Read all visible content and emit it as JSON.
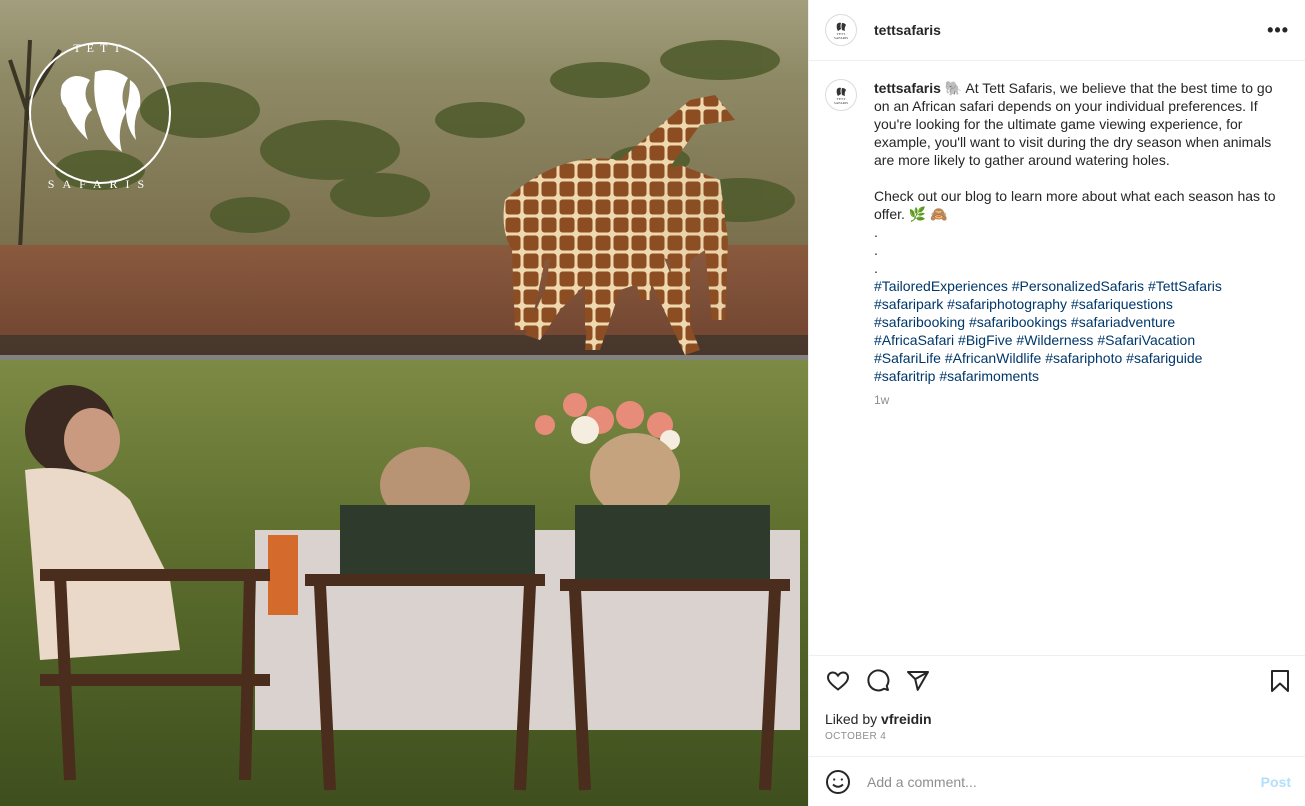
{
  "post": {
    "brand_logo_text": "TETT SAFARIS",
    "username": "tettsafaris",
    "caption": {
      "username": "tettsafaris",
      "paragraph1": "🐘 At Tett Safaris, we believe that the best time to go on an African safari depends on your individual preferences. If you're looking for the ultimate game viewing experience, for example, you'll want to visit during the dry season when animals are more likely to gather around watering holes.",
      "paragraph2": "Check out our blog to learn more about what each season has to offer. 🌿 🙈",
      "dots": [
        ".",
        ".",
        "."
      ],
      "hashtags": [
        "#TailoredExperiences",
        "#PersonalizedSafaris",
        "#TettSafaris",
        "#safaripark",
        "#safariphotography",
        "#safariquestions",
        "#safaribooking",
        "#safaribookings",
        "#safariadventure",
        "#AfricaSafari",
        "#BigFive",
        "#Wilderness",
        "#SafariVacation",
        "#SafariLife",
        "#AfricanWildlife",
        "#safariphoto",
        "#safariguide",
        "#safaritrip",
        "#safarimoments"
      ],
      "time_ago": "1w"
    },
    "likes": {
      "prefix": "Liked by",
      "user": "vfreidin"
    },
    "date": "OCTOBER 4",
    "comment": {
      "placeholder": "Add a comment...",
      "post_label": "Post"
    },
    "icons": {
      "more": "more-options-icon",
      "like": "heart-icon",
      "comment": "comment-icon",
      "share": "send-icon",
      "save": "bookmark-icon",
      "emoji": "emoji-icon"
    },
    "colors": {
      "link": "#00376b",
      "muted": "#8e8e8e",
      "post_button": "#b2dffc"
    }
  }
}
